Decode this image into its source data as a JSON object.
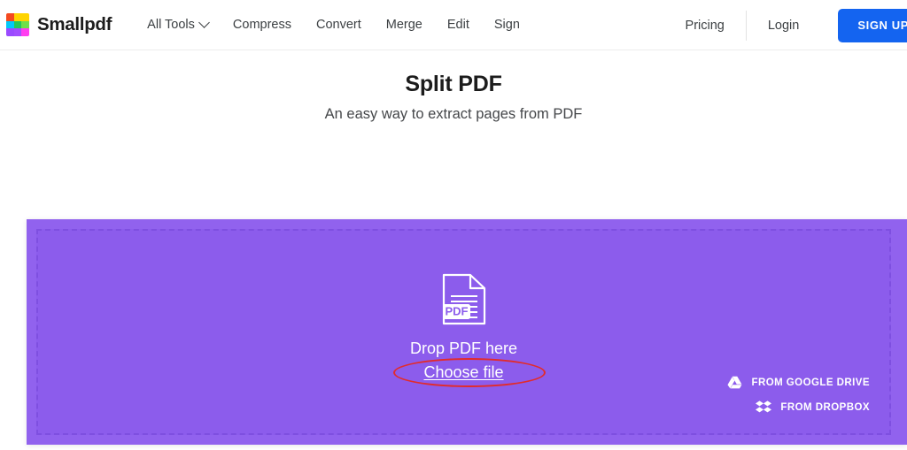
{
  "header": {
    "brand_name": "Smallpdf",
    "logo_colors": [
      "#f44a20",
      "#ffd400",
      "#ffd400",
      "#00c8f8",
      "#21c957",
      "#6fe04a",
      "#9a4aff",
      "#a24dff",
      "#ff3ef0"
    ],
    "nav_items": [
      {
        "label": "All Tools",
        "has_chevron": true
      },
      {
        "label": "Compress",
        "has_chevron": false
      },
      {
        "label": "Convert",
        "has_chevron": false
      },
      {
        "label": "Merge",
        "has_chevron": false
      },
      {
        "label": "Edit",
        "has_chevron": false
      },
      {
        "label": "Sign",
        "has_chevron": false
      }
    ],
    "pricing_label": "Pricing",
    "login_label": "Login",
    "signup_label": "SIGN UP",
    "signup_color": "#1464f0"
  },
  "main": {
    "title": "Split PDF",
    "subtitle": "An easy way to extract pages from PDF"
  },
  "dropzone": {
    "icon_name": "pdf-file-icon",
    "icon_badge_text": "PDF",
    "drop_label": "Drop PDF here",
    "choose_file_label": "Choose file",
    "outer_color": "#9162ee",
    "inner_color": "#8c5cec",
    "dash_color": "#7e4fe0",
    "annotation_color": "#e22b2b",
    "cloud_links": [
      {
        "label": "FROM GOOGLE DRIVE",
        "icon": "google-drive-icon"
      },
      {
        "label": "FROM DROPBOX",
        "icon": "dropbox-icon"
      }
    ]
  }
}
